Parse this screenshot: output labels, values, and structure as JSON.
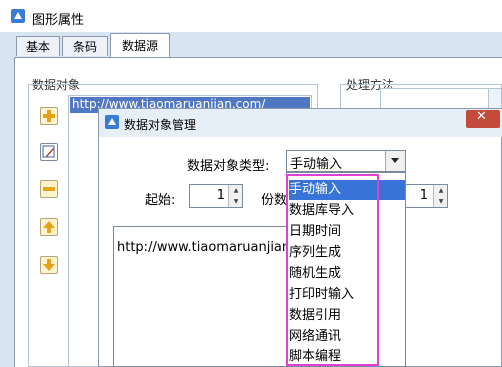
{
  "window": {
    "title": "图形属性"
  },
  "tabs": [
    {
      "label": "基本"
    },
    {
      "label": "条码"
    },
    {
      "label": "数据源"
    }
  ],
  "left": {
    "group_label": "数据对象",
    "list_items": [
      "http://www.tiaomaruanjian.com/"
    ]
  },
  "right": {
    "group_label": "处理方法"
  },
  "dialog": {
    "title": "数据对象管理",
    "type_label": "数据对象类型:",
    "type_value": "手动输入",
    "start_label": "起始:",
    "start_value": "1",
    "copies_label": "份数",
    "copies_value": "1",
    "text_value": "http://www.tiaomaruanjian.com/"
  },
  "dropdown": {
    "options": [
      "手动输入",
      "数据库导入",
      "日期时间",
      "序列生成",
      "随机生成",
      "打印时输入",
      "数据引用",
      "网络通讯",
      "脚本编程"
    ],
    "selected": "手动输入"
  },
  "colors": {
    "accent": "#3874d8",
    "highlight": "#e040d4",
    "close": "#c44b3b"
  }
}
